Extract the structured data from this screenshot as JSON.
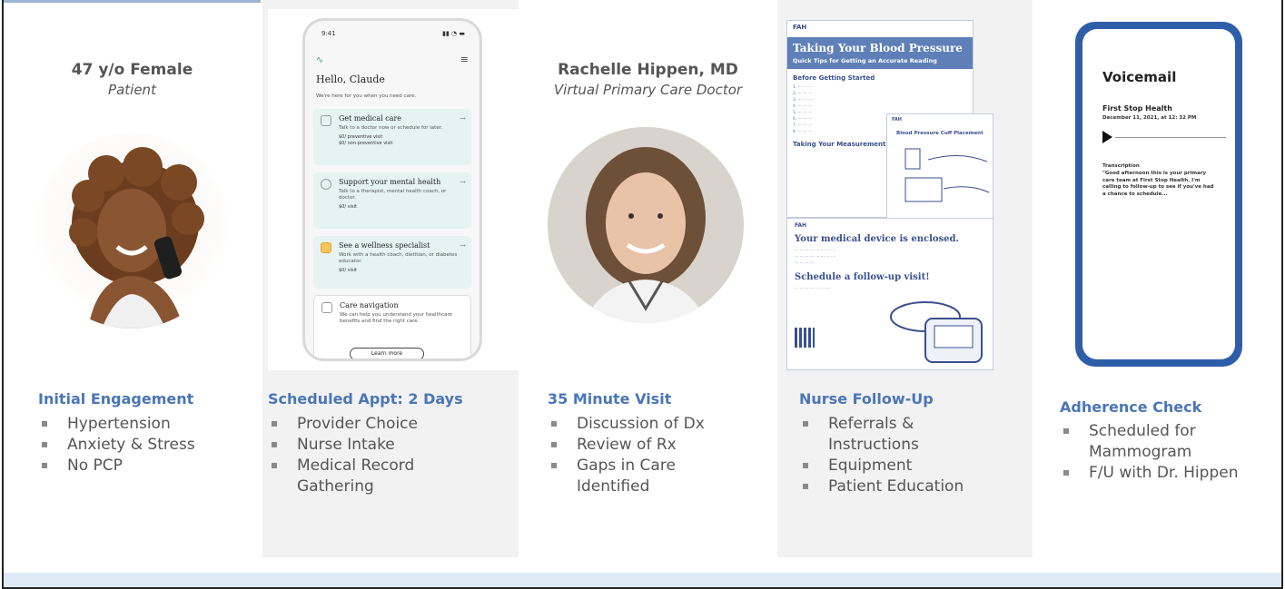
{
  "columns": [
    {
      "person": {
        "name": "47 y/o Female",
        "role": "Patient"
      },
      "heading": "Initial Engagement",
      "bullets": [
        "Hypertension",
        "Anxiety & Stress",
        "No PCP"
      ]
    },
    {
      "app": {
        "time": "9:41",
        "greeting": "Hello, Claude",
        "subtitle": "We're here for you when you need care.",
        "cards": [
          {
            "title": "Get medical care",
            "desc": "Talk to a doctor now or schedule for later.",
            "price1": "$0/ preventive visit",
            "price2": "$0/ non-preventive visit"
          },
          {
            "title": "Support your mental health",
            "desc": "Talk to a therapist, mental health coach, or doctor.",
            "price1": "$0/ visit",
            "price2": ""
          },
          {
            "title": "See a wellness specialist",
            "desc": "Work with a health coach, dietitian, or diabetes educator.",
            "price1": "$0/ visit",
            "price2": ""
          },
          {
            "title": "Care navigation",
            "desc": "We can help you understand your healthcare benefits and find the right care.",
            "price1": "",
            "price2": ""
          }
        ],
        "learn_more": "Learn more"
      },
      "heading": "Scheduled Appt: 2 Days",
      "bullets": [
        "Provider Choice",
        "Nurse Intake",
        "Medical Record Gathering"
      ]
    },
    {
      "person": {
        "name": "Rachelle Hippen, MD",
        "role": "Virtual Primary Care Doctor"
      },
      "heading": "35 Minute Visit",
      "bullets": [
        "Discussion of Dx",
        "Review of Rx",
        "Gaps in Care Identified"
      ]
    },
    {
      "doc": {
        "logo": "FAH",
        "title": "Taking Your Blood Pressure",
        "subtitle": "Quick Tips for Getting an Accurate Reading",
        "section1": "Before Getting Started",
        "section2": "Taking Your Measurement",
        "cuff_title": "Blood Pressure Cuff Placement",
        "card_title": "Your medical device is enclosed.",
        "card_sub": "Schedule a follow-up visit!"
      },
      "heading": "Nurse Follow-Up",
      "bullets": [
        "Referrals & Instructions",
        "Equipment",
        "Patient Education"
      ]
    },
    {
      "voicemail": {
        "title": "Voicemail",
        "from": "First Stop Health",
        "date": "December 11, 2021, at 12: 32 PM",
        "trans_label": "Transcription",
        "transcript": "\"Good afternoon this is your primary care team at First Stop Health. I'm calling to follow-up to see if you've had a chance to schedule..."
      },
      "heading": "Adherence Check",
      "bullets": [
        "Scheduled for Mammogram",
        "F/U with Dr. Hippen"
      ]
    }
  ],
  "colors": {
    "accent": "#4a76b8",
    "shade": "#f2f2f2",
    "band": "#dfe8f5",
    "voicemail_phone": "#2f5ea9"
  }
}
